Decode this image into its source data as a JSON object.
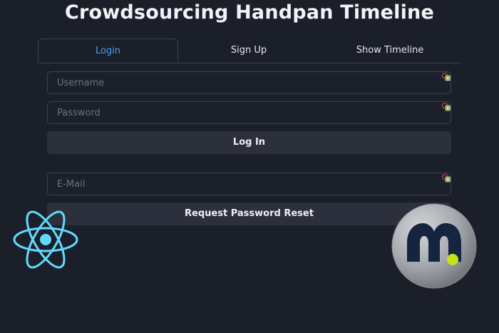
{
  "page": {
    "title": "Crowdsourcing Handpan Timeline"
  },
  "tabs": [
    {
      "label": "Login",
      "active": true
    },
    {
      "label": "Sign Up",
      "active": false
    },
    {
      "label": "Show Timeline",
      "active": false
    }
  ],
  "login_form": {
    "username": {
      "placeholder": "Username",
      "value": ""
    },
    "password": {
      "placeholder": "Password",
      "value": ""
    },
    "login_button": "Log In"
  },
  "reset_form": {
    "email": {
      "placeholder": "E-Mail",
      "value": ""
    },
    "reset_button": "Request Password Reset"
  },
  "icons": {
    "password_manager": "password-manager-icon",
    "react_logo": "react-logo",
    "app_logo": "m-logo"
  },
  "colors": {
    "background": "#1b1f2a",
    "accent": "#4f9ef0",
    "button": "#2c303c",
    "react": "#61dafb",
    "logo_dot": "#c5e21a"
  }
}
